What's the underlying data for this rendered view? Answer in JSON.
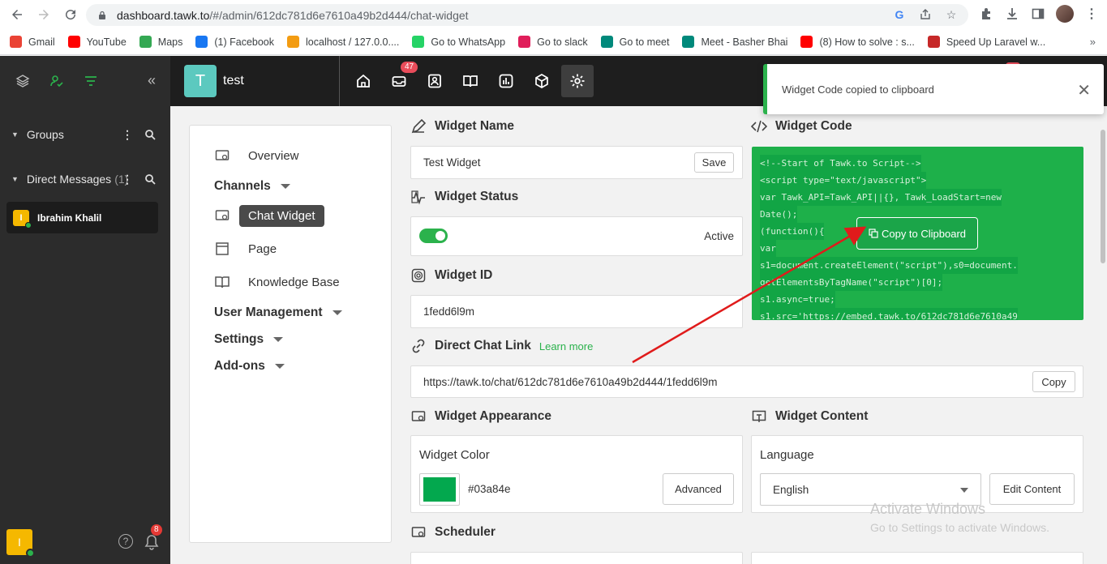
{
  "browser": {
    "url_host": "dashboard.tawk.to",
    "url_path": "/#/admin/612dc781d6e7610a49b2d444/chat-widget",
    "bookmarks": [
      {
        "label": "Gmail",
        "icon": "gmail-icon",
        "color": "#ea4335"
      },
      {
        "label": "YouTube",
        "icon": "youtube-icon",
        "color": "#ff0000"
      },
      {
        "label": "Maps",
        "icon": "maps-icon",
        "color": "#34a853"
      },
      {
        "label": "(1) Facebook",
        "icon": "facebook-icon",
        "color": "#1877f2"
      },
      {
        "label": "localhost / 127.0.0....",
        "icon": "phpmyadmin-icon",
        "color": "#f39c12"
      },
      {
        "label": "Go to WhatsApp",
        "icon": "whatsapp-icon",
        "color": "#25d366"
      },
      {
        "label": "Go to slack",
        "icon": "slack-icon",
        "color": "#e01e5a"
      },
      {
        "label": "Go to meet",
        "icon": "meet-icon",
        "color": "#00897b"
      },
      {
        "label": "Meet - Basher Bhai",
        "icon": "meet-icon",
        "color": "#00897b"
      },
      {
        "label": "(8) How to solve : s...",
        "icon": "youtube-icon",
        "color": "#ff0000"
      },
      {
        "label": "Speed Up Laravel w...",
        "icon": "laravel-icon",
        "color": "#c62828"
      }
    ]
  },
  "sidebar": {
    "groups_label": "Groups",
    "dm_label": "Direct Messages",
    "dm_count": "(1)",
    "contact_name": "Ibrahim Khalil",
    "contact_initial": "I",
    "user_initial": "I",
    "notif_count": "8"
  },
  "topbar": {
    "property_initial": "T",
    "property_name": "test",
    "inbox_badge": "47"
  },
  "menu": {
    "overview": "Overview",
    "channels": "Channels",
    "chat_widget": "Chat Widget",
    "page": "Page",
    "knowledge_base": "Knowledge Base",
    "user_management": "User Management",
    "settings": "Settings",
    "addons": "Add-ons"
  },
  "widget_name": {
    "title": "Widget Name",
    "value": "Test Widget",
    "save": "Save"
  },
  "widget_status": {
    "title": "Widget Status",
    "status": "Active"
  },
  "widget_id": {
    "title": "Widget ID",
    "value": "1fedd6l9m"
  },
  "direct_link": {
    "title": "Direct Chat Link",
    "learn_more": "Learn more",
    "value": "https://tawk.to/chat/612dc781d6e7610a49b2d444/1fedd6l9m",
    "copy": "Copy"
  },
  "widget_code": {
    "title": "Widget Code",
    "lines": [
      "<!--Start of Tawk.to Script-->",
      "<script type=\"text/javascript\">",
      "var Tawk_API=Tawk_API||{}, Tawk_LoadStart=new",
      "Date();",
      "(function(){",
      "var",
      "s1=document.createElement(\"script\"),s0=document.",
      "getElementsByTagName(\"script\")[0];",
      "s1.async=true;",
      "s1.src='https://embed.tawk.to/612dc781d6e7610a49"
    ],
    "copy_button": "Copy to Clipboard"
  },
  "appearance": {
    "title": "Widget Appearance",
    "color_label": "Widget Color",
    "color_value": "#03a84e",
    "advanced": "Advanced"
  },
  "content": {
    "title": "Widget Content",
    "language_label": "Language",
    "language_value": "English",
    "edit_content": "Edit Content"
  },
  "scheduler": {
    "title": "Scheduler"
  },
  "toast": {
    "message": "Widget Code copied to clipboard"
  },
  "watermark": {
    "line1": "Activate Windows",
    "line2": "Go to Settings to activate Windows."
  },
  "colors": {
    "accent": "#2bb24c",
    "code_bg": "#1eb04a",
    "badge": "#e94c5a",
    "annotation_arrow": "#e01b1b"
  }
}
